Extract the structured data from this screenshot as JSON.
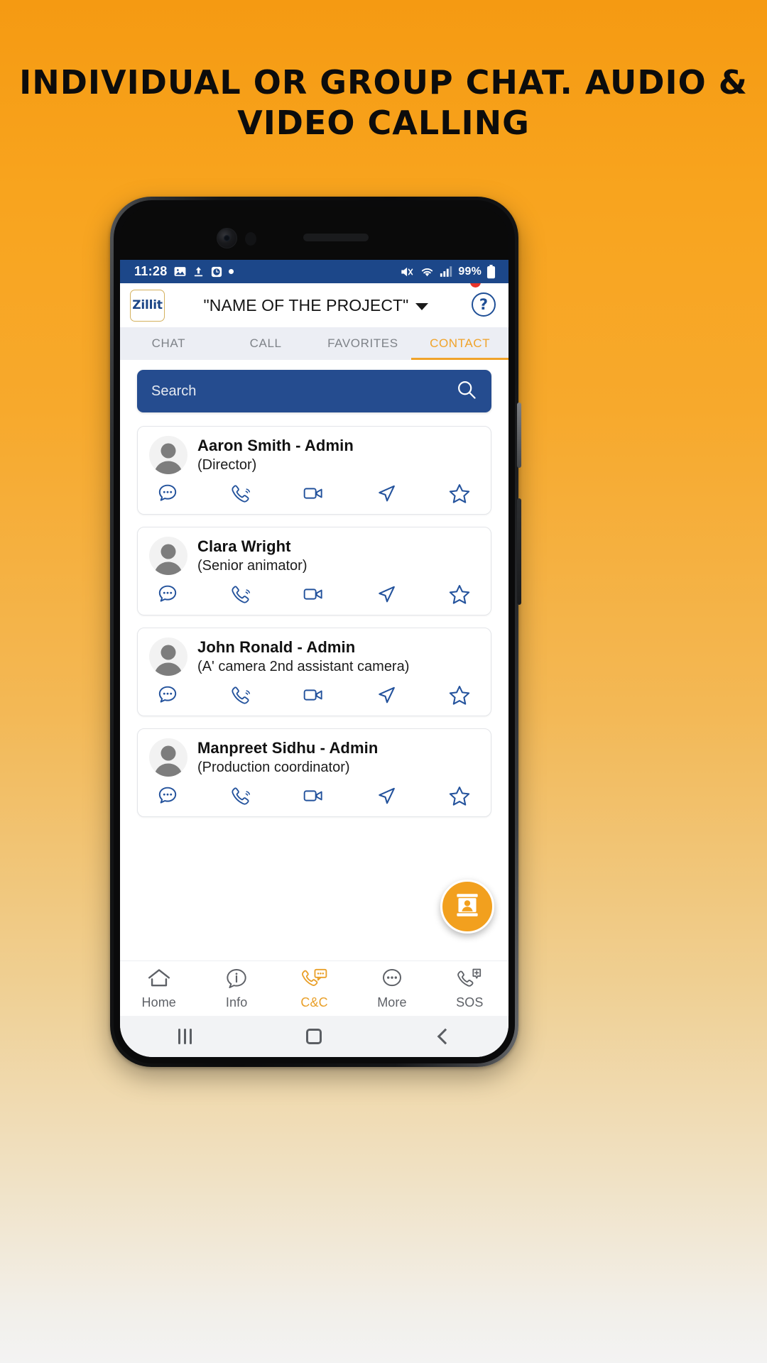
{
  "promo": {
    "headline": "INDIVIDUAL OR GROUP CHAT. AUDIO & VIDEO CALLING"
  },
  "colors": {
    "background_top": "#f59a12",
    "background_bottom": "#f3f3f3",
    "status_bar": "#1c4789",
    "search_bar": "#254c8f",
    "accent_orange": "#f0a32a",
    "icon_blue": "#1f4f96",
    "logo_border": "#d4b15e",
    "badge_red": "#e8342a"
  },
  "status_bar": {
    "time": "11:28",
    "left_icons": [
      "image-icon",
      "upload-icon",
      "alarm-icon",
      "dot-icon"
    ],
    "right_icons": [
      "mute-icon",
      "wifi-icon",
      "signal-icon"
    ],
    "battery_level": "99%",
    "battery_icon": "battery-icon"
  },
  "header": {
    "logo_text": "Zillit",
    "project_name": "\"NAME OF THE PROJECT\"",
    "dropdown_icon": "chevron-down-icon",
    "help_label": "?",
    "help_icon": "help-circle-icon",
    "notification_badge": true
  },
  "tabs": [
    {
      "label": "CHAT",
      "active": false
    },
    {
      "label": "CALL",
      "active": false
    },
    {
      "label": "FAVORITES",
      "active": false
    },
    {
      "label": "CONTACT",
      "active": true
    }
  ],
  "search": {
    "placeholder": "Search",
    "value": "",
    "icon": "search-icon"
  },
  "contacts": [
    {
      "name": "Aaron Smith - Admin",
      "role": "(Director)",
      "avatar": "user-avatar"
    },
    {
      "name": "Clara Wright",
      "role": "(Senior animator)",
      "avatar": "user-avatar"
    },
    {
      "name": "John Ronald - Admin",
      "role": "(A' camera 2nd assistant camera)",
      "avatar": "user-avatar"
    },
    {
      "name": "Manpreet Sidhu - Admin",
      "role": "(Production coordinator)",
      "avatar": "user-avatar"
    }
  ],
  "contact_actions": [
    "chat-bubble-icon",
    "phone-call-icon",
    "video-camera-icon",
    "send-icon",
    "star-icon"
  ],
  "fab": {
    "icon": "contact-card-icon",
    "label": ""
  },
  "bottom_nav": [
    {
      "label": "Home",
      "icon": "home-icon",
      "active": false
    },
    {
      "label": "Info",
      "icon": "info-bubble-icon",
      "active": false
    },
    {
      "label": "C&C",
      "icon": "call-chat-icon",
      "active": true
    },
    {
      "label": "More",
      "icon": "more-dots-icon",
      "active": false
    },
    {
      "label": "SOS",
      "icon": "sos-phone-icon",
      "active": false
    }
  ],
  "android_nav": [
    {
      "icon": "recents-icon"
    },
    {
      "icon": "home-circle-icon"
    },
    {
      "icon": "back-icon"
    }
  ]
}
